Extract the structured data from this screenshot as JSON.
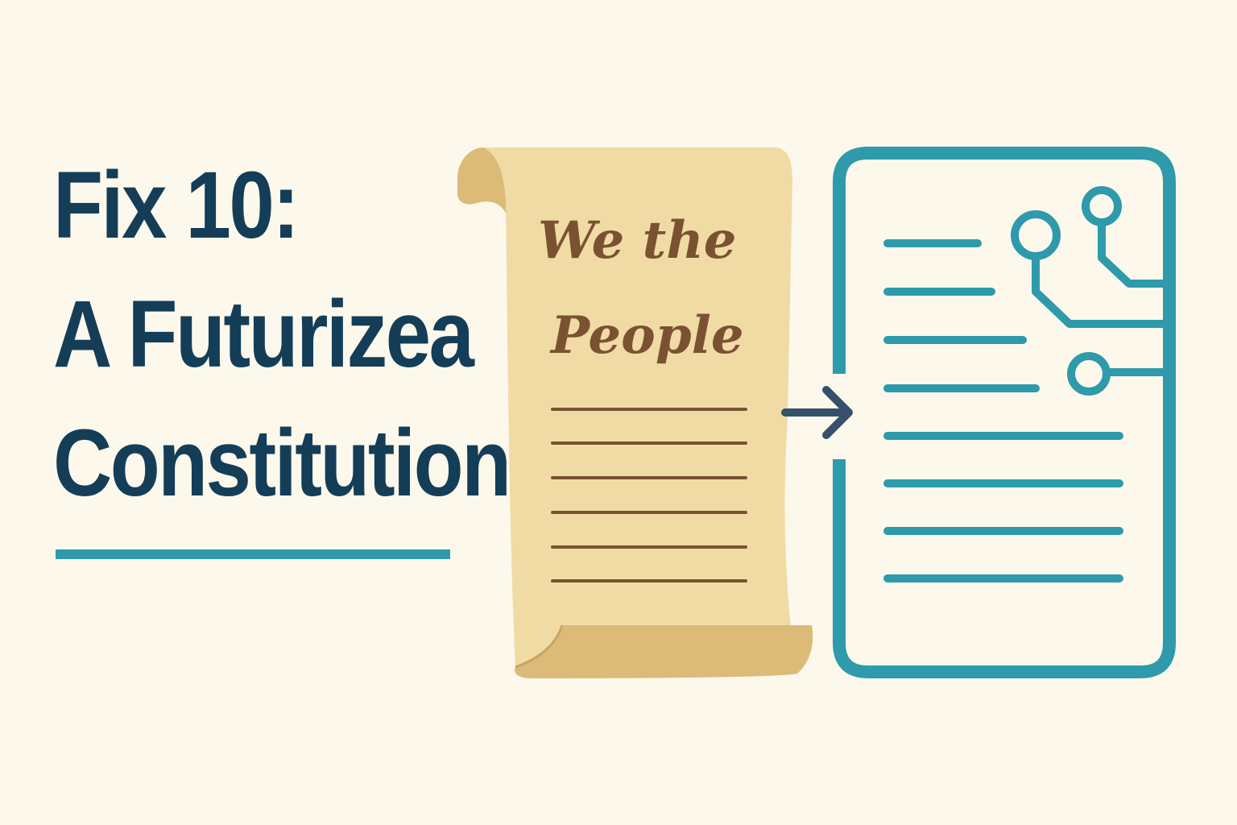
{
  "headline": {
    "line1": "Fix 10:",
    "line2": "A Futurizea",
    "line3": "Constitution"
  },
  "scroll": {
    "line1": "We the",
    "line2": "People"
  },
  "colors": {
    "background": "#fcf9ec",
    "headline": "#143d58",
    "accent": "#2e9aab",
    "parchment": "#f1dba5",
    "parchment_shadow": "#dcbb78",
    "ink": "#7a5232",
    "arrow": "#35506a"
  },
  "icons": {
    "scroll": "parchment-scroll-icon",
    "arrow": "arrow-right-icon",
    "digital_doc": "digital-document-circuit-icon"
  }
}
